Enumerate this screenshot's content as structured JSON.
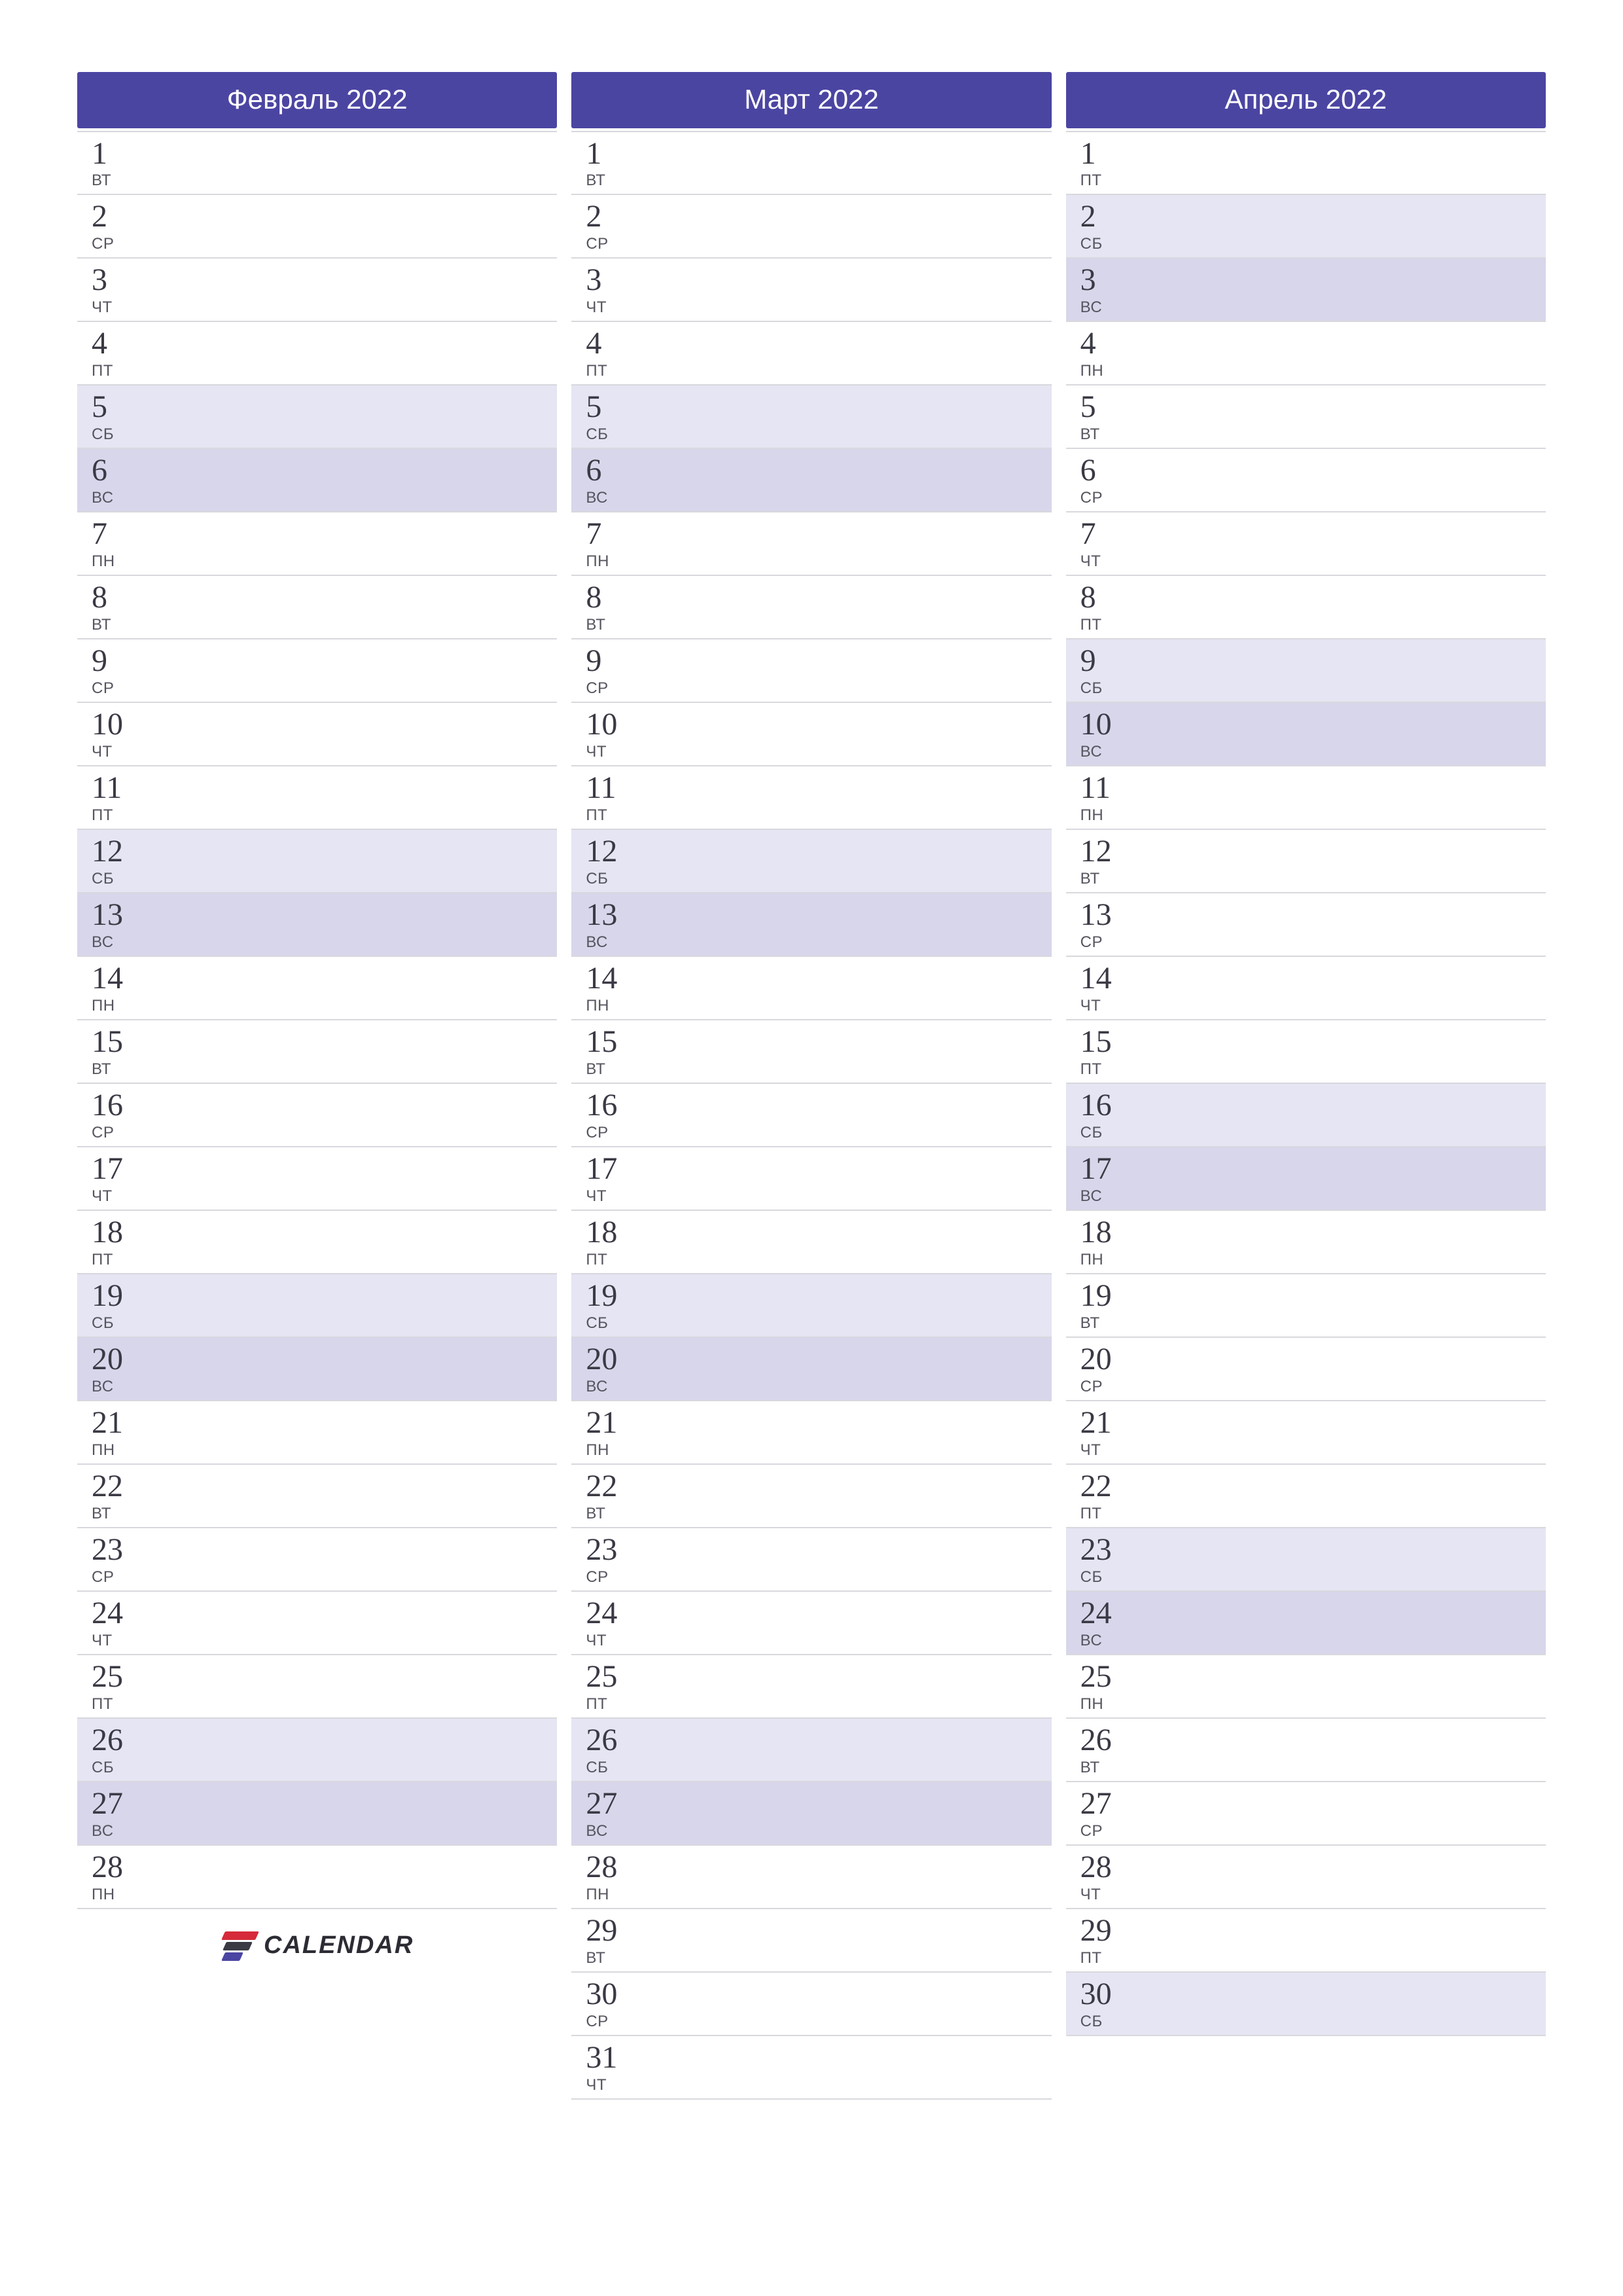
{
  "dow_labels": {
    "mon": "ПН",
    "tue": "ВТ",
    "wed": "СР",
    "thu": "ЧТ",
    "fri": "ПТ",
    "sat": "СБ",
    "sun": "ВС"
  },
  "brand": {
    "text": "CALENDAR"
  },
  "colors": {
    "header": "#4b45a2",
    "sat": "#e5e5f3",
    "sun": "#d8d6eb"
  },
  "months": [
    {
      "title": "Февраль 2022",
      "days": [
        {
          "n": 1,
          "w": "tue"
        },
        {
          "n": 2,
          "w": "wed"
        },
        {
          "n": 3,
          "w": "thu"
        },
        {
          "n": 4,
          "w": "fri"
        },
        {
          "n": 5,
          "w": "sat"
        },
        {
          "n": 6,
          "w": "sun"
        },
        {
          "n": 7,
          "w": "mon"
        },
        {
          "n": 8,
          "w": "tue"
        },
        {
          "n": 9,
          "w": "wed"
        },
        {
          "n": 10,
          "w": "thu"
        },
        {
          "n": 11,
          "w": "fri"
        },
        {
          "n": 12,
          "w": "sat"
        },
        {
          "n": 13,
          "w": "sun"
        },
        {
          "n": 14,
          "w": "mon"
        },
        {
          "n": 15,
          "w": "tue"
        },
        {
          "n": 16,
          "w": "wed"
        },
        {
          "n": 17,
          "w": "thu"
        },
        {
          "n": 18,
          "w": "fri"
        },
        {
          "n": 19,
          "w": "sat"
        },
        {
          "n": 20,
          "w": "sun"
        },
        {
          "n": 21,
          "w": "mon"
        },
        {
          "n": 22,
          "w": "tue"
        },
        {
          "n": 23,
          "w": "wed"
        },
        {
          "n": 24,
          "w": "thu"
        },
        {
          "n": 25,
          "w": "fri"
        },
        {
          "n": 26,
          "w": "sat"
        },
        {
          "n": 27,
          "w": "sun"
        },
        {
          "n": 28,
          "w": "mon"
        }
      ],
      "has_logo_after": true
    },
    {
      "title": "Март 2022",
      "days": [
        {
          "n": 1,
          "w": "tue"
        },
        {
          "n": 2,
          "w": "wed"
        },
        {
          "n": 3,
          "w": "thu"
        },
        {
          "n": 4,
          "w": "fri"
        },
        {
          "n": 5,
          "w": "sat"
        },
        {
          "n": 6,
          "w": "sun"
        },
        {
          "n": 7,
          "w": "mon"
        },
        {
          "n": 8,
          "w": "tue"
        },
        {
          "n": 9,
          "w": "wed"
        },
        {
          "n": 10,
          "w": "thu"
        },
        {
          "n": 11,
          "w": "fri"
        },
        {
          "n": 12,
          "w": "sat"
        },
        {
          "n": 13,
          "w": "sun"
        },
        {
          "n": 14,
          "w": "mon"
        },
        {
          "n": 15,
          "w": "tue"
        },
        {
          "n": 16,
          "w": "wed"
        },
        {
          "n": 17,
          "w": "thu"
        },
        {
          "n": 18,
          "w": "fri"
        },
        {
          "n": 19,
          "w": "sat"
        },
        {
          "n": 20,
          "w": "sun"
        },
        {
          "n": 21,
          "w": "mon"
        },
        {
          "n": 22,
          "w": "tue"
        },
        {
          "n": 23,
          "w": "wed"
        },
        {
          "n": 24,
          "w": "thu"
        },
        {
          "n": 25,
          "w": "fri"
        },
        {
          "n": 26,
          "w": "sat"
        },
        {
          "n": 27,
          "w": "sun"
        },
        {
          "n": 28,
          "w": "mon"
        },
        {
          "n": 29,
          "w": "tue"
        },
        {
          "n": 30,
          "w": "wed"
        },
        {
          "n": 31,
          "w": "thu"
        }
      ],
      "has_logo_after": false
    },
    {
      "title": "Апрель 2022",
      "days": [
        {
          "n": 1,
          "w": "fri"
        },
        {
          "n": 2,
          "w": "sat"
        },
        {
          "n": 3,
          "w": "sun"
        },
        {
          "n": 4,
          "w": "mon"
        },
        {
          "n": 5,
          "w": "tue"
        },
        {
          "n": 6,
          "w": "wed"
        },
        {
          "n": 7,
          "w": "thu"
        },
        {
          "n": 8,
          "w": "fri"
        },
        {
          "n": 9,
          "w": "sat"
        },
        {
          "n": 10,
          "w": "sun"
        },
        {
          "n": 11,
          "w": "mon"
        },
        {
          "n": 12,
          "w": "tue"
        },
        {
          "n": 13,
          "w": "wed"
        },
        {
          "n": 14,
          "w": "thu"
        },
        {
          "n": 15,
          "w": "fri"
        },
        {
          "n": 16,
          "w": "sat"
        },
        {
          "n": 17,
          "w": "sun"
        },
        {
          "n": 18,
          "w": "mon"
        },
        {
          "n": 19,
          "w": "tue"
        },
        {
          "n": 20,
          "w": "wed"
        },
        {
          "n": 21,
          "w": "thu"
        },
        {
          "n": 22,
          "w": "fri"
        },
        {
          "n": 23,
          "w": "sat"
        },
        {
          "n": 24,
          "w": "sun"
        },
        {
          "n": 25,
          "w": "mon"
        },
        {
          "n": 26,
          "w": "tue"
        },
        {
          "n": 27,
          "w": "wed"
        },
        {
          "n": 28,
          "w": "thu"
        },
        {
          "n": 29,
          "w": "fri"
        },
        {
          "n": 30,
          "w": "sat"
        }
      ],
      "has_logo_after": false
    }
  ]
}
